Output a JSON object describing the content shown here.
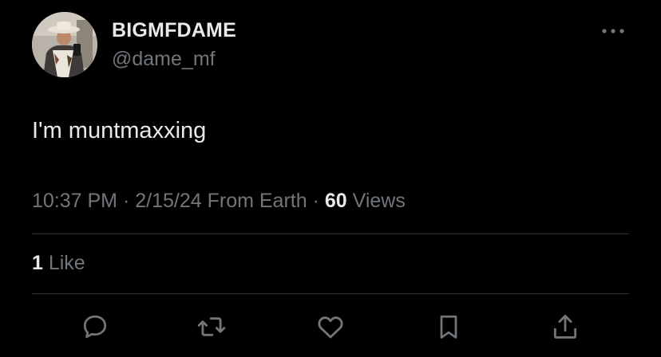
{
  "author": {
    "display_name": "BIGMFDAME",
    "handle": "@dame_mf",
    "avatar_icon": "profile-photo"
  },
  "tweet": {
    "text": "I'm muntmaxxing"
  },
  "meta": {
    "time": "10:37 PM",
    "separator1": " · ",
    "date": "2/15/24",
    "location": " From Earth",
    "separator2": " · ",
    "views_count": "60",
    "views_label": " Views"
  },
  "engagement": {
    "likes_count": "1",
    "likes_label": " Like"
  },
  "actions": [
    {
      "icon": "reply-icon"
    },
    {
      "icon": "retweet-icon"
    },
    {
      "icon": "like-icon"
    },
    {
      "icon": "bookmark-icon"
    },
    {
      "icon": "share-icon"
    }
  ],
  "colors": {
    "background": "#000000",
    "primary_text": "#e7e9ea",
    "secondary_text": "#71767b",
    "divider": "#2f3336"
  }
}
